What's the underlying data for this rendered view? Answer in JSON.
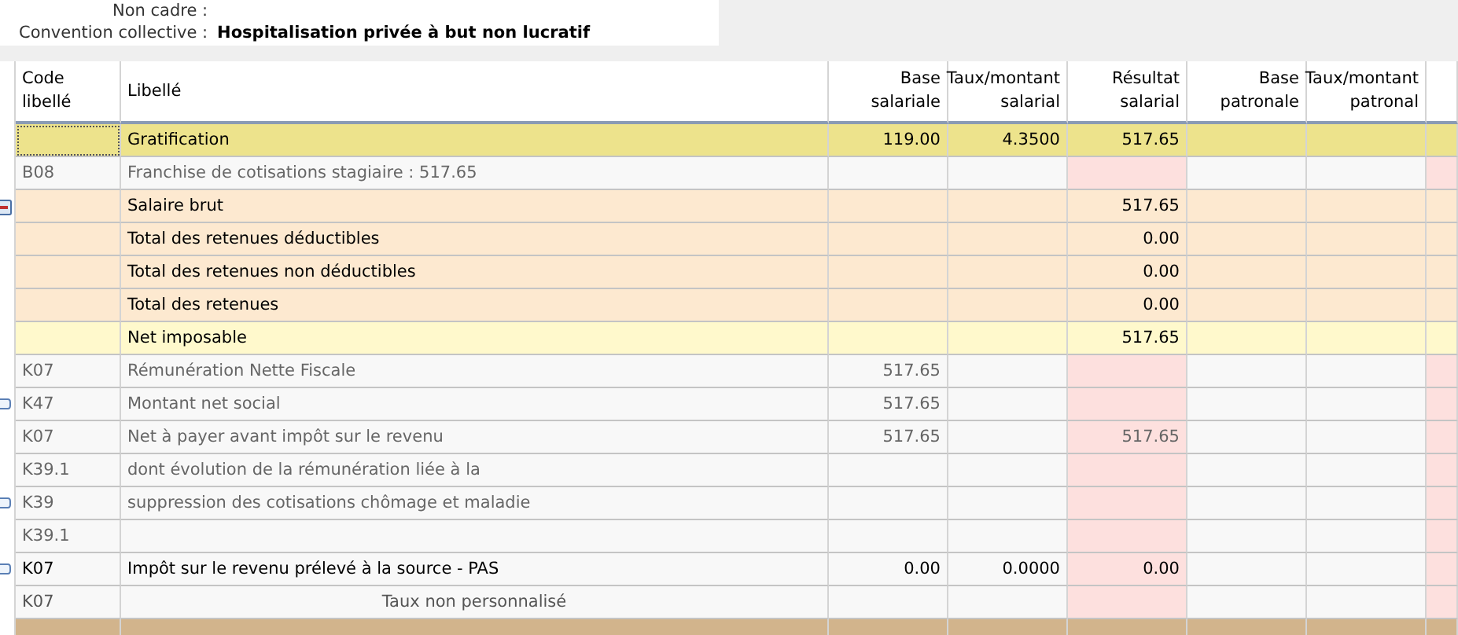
{
  "info": {
    "fields": [
      {
        "label": "Non cadre :"
      },
      {
        "label": "Convention collective :",
        "value": "Hospitalisation privée à but non lucratif"
      }
    ]
  },
  "table": {
    "columns": [
      {
        "lines": [
          "Code",
          "libellé"
        ]
      },
      {
        "lines": [
          "Libellé"
        ]
      },
      {
        "lines": [
          "Base",
          "salariale"
        ]
      },
      {
        "lines": [
          "Taux/montant",
          "salarial"
        ]
      },
      {
        "lines": [
          "Résultat",
          "salarial"
        ]
      },
      {
        "lines": [
          "Base",
          "patronale"
        ]
      },
      {
        "lines": [
          "Taux/montant",
          "patronal"
        ]
      }
    ],
    "rows": [
      {
        "kind": "rubric",
        "selected": true,
        "code": "",
        "label": "Gratification",
        "base_sal": "119.00",
        "taux_sal": "4.3500",
        "res_sal": "517.65"
      },
      {
        "kind": "info",
        "selected": false,
        "code": "B08",
        "label": "Franchise de cotisations stagiaire : 517.65"
      },
      {
        "kind": "subtotal",
        "selected": false,
        "expanded": true,
        "code": "",
        "label": "Salaire brut",
        "res_sal": "517.65"
      },
      {
        "kind": "subtotal",
        "selected": false,
        "code": "",
        "label": "Total des retenues déductibles",
        "res_sal": "0.00"
      },
      {
        "kind": "subtotal",
        "selected": false,
        "code": "",
        "label": "Total des retenues non déductibles",
        "res_sal": "0.00"
      },
      {
        "kind": "subtotal",
        "selected": false,
        "code": "",
        "label": "Total des retenues",
        "res_sal": "0.00"
      },
      {
        "kind": "net",
        "selected": false,
        "code": "",
        "label": "Net imposable",
        "res_sal": "517.65"
      },
      {
        "kind": "info",
        "selected": false,
        "code": "K07",
        "label": "Rémunération Nette Fiscale",
        "base_sal": "517.65"
      },
      {
        "kind": "info",
        "selected": false,
        "note": true,
        "code": "K47",
        "label": "Montant net social",
        "base_sal": "517.65"
      },
      {
        "kind": "info",
        "selected": false,
        "code": "K07",
        "label": "Net à payer avant impôt sur le revenu",
        "base_sal": "517.65",
        "res_sal": "517.65"
      },
      {
        "kind": "info",
        "selected": false,
        "code": "K39.1",
        "label": "dont évolution de la rémunération liée à la"
      },
      {
        "kind": "info",
        "selected": false,
        "note": true,
        "code": "K39",
        "label": "suppression des cotisations chômage et maladie"
      },
      {
        "kind": "info",
        "selected": false,
        "code": "K39.1",
        "label": ""
      },
      {
        "kind": "tax",
        "selected": false,
        "note": true,
        "code": "K07",
        "label": "Impôt sur le revenu prélevé à la source - PAS",
        "base_sal": "0.00",
        "taux_sal": "0.0000",
        "res_sal": "0.00"
      },
      {
        "kind": "centered",
        "selected": false,
        "code": "K07",
        "label": "Taux non personnalisé"
      },
      {
        "kind": "total",
        "selected": false,
        "code": "",
        "label": ""
      }
    ]
  }
}
